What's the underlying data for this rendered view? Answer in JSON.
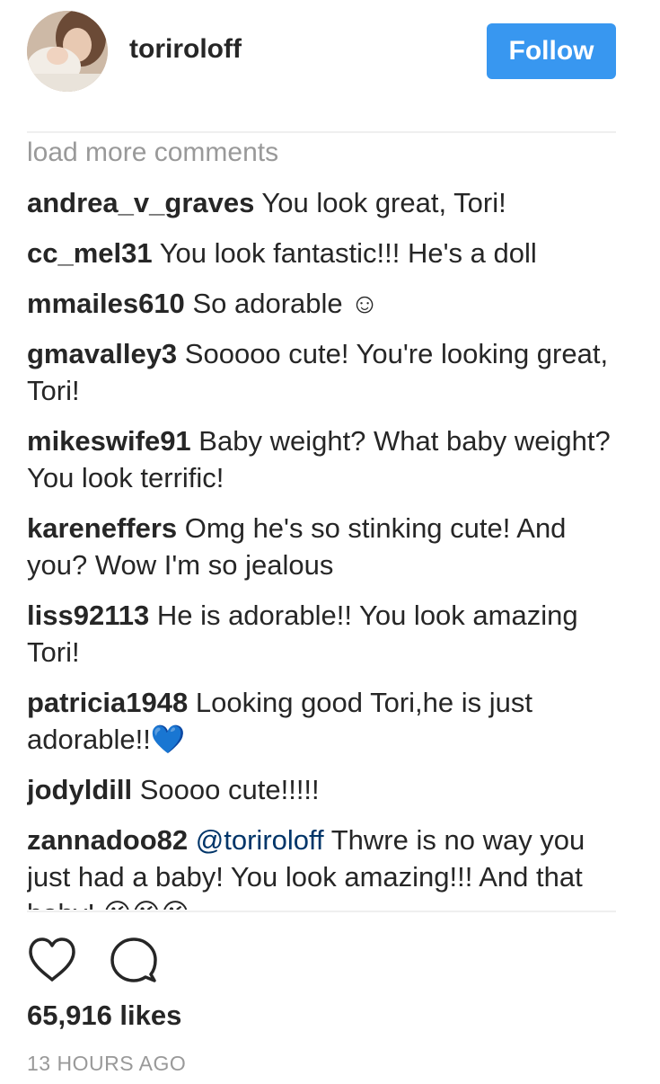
{
  "post": {
    "username": "toriroloff",
    "follow_label": "Follow"
  },
  "comments": {
    "load_more": "load more comments",
    "items": [
      {
        "author": "andrea_v_graves",
        "text": "You look great, Tori!"
      },
      {
        "author": "cc_mel31",
        "text": "You look fantastic!!! He's a doll"
      },
      {
        "author": "mmailes610",
        "text": "So adorable ☺"
      },
      {
        "author": "gmavalley3",
        "text": "Sooooo cute! You're looking great, Tori!"
      },
      {
        "author": "mikeswife91",
        "text": "Baby weight? What baby weight? You look terrific!"
      },
      {
        "author": "kareneffers",
        "text": "Omg he's so stinking cute! And you? Wow I'm so jealous"
      },
      {
        "author": "liss92113",
        "text": "He is adorable!! You look amazing Tori!"
      },
      {
        "author": "patricia1948",
        "text": "Looking good Tori,he is just adorable!!💙"
      },
      {
        "author": "jodyldill",
        "text": "Soooo cute!!!!!"
      },
      {
        "author": "zannadoo82",
        "mention": "@toriroloff",
        "text": "Thwre is no way you just had a baby! You look amazing!!! And that baby! 😘😘😘"
      }
    ]
  },
  "actions": {
    "like_icon": "heart-outline-icon",
    "comment_icon": "comment-bubble-icon"
  },
  "stats": {
    "likes": "65,916 likes",
    "timestamp": "13 HOURS AGO"
  },
  "colors": {
    "follow_button": "#3897f0",
    "text": "#262626",
    "muted": "#999999",
    "mention": "#003569",
    "divider": "#efefef"
  }
}
